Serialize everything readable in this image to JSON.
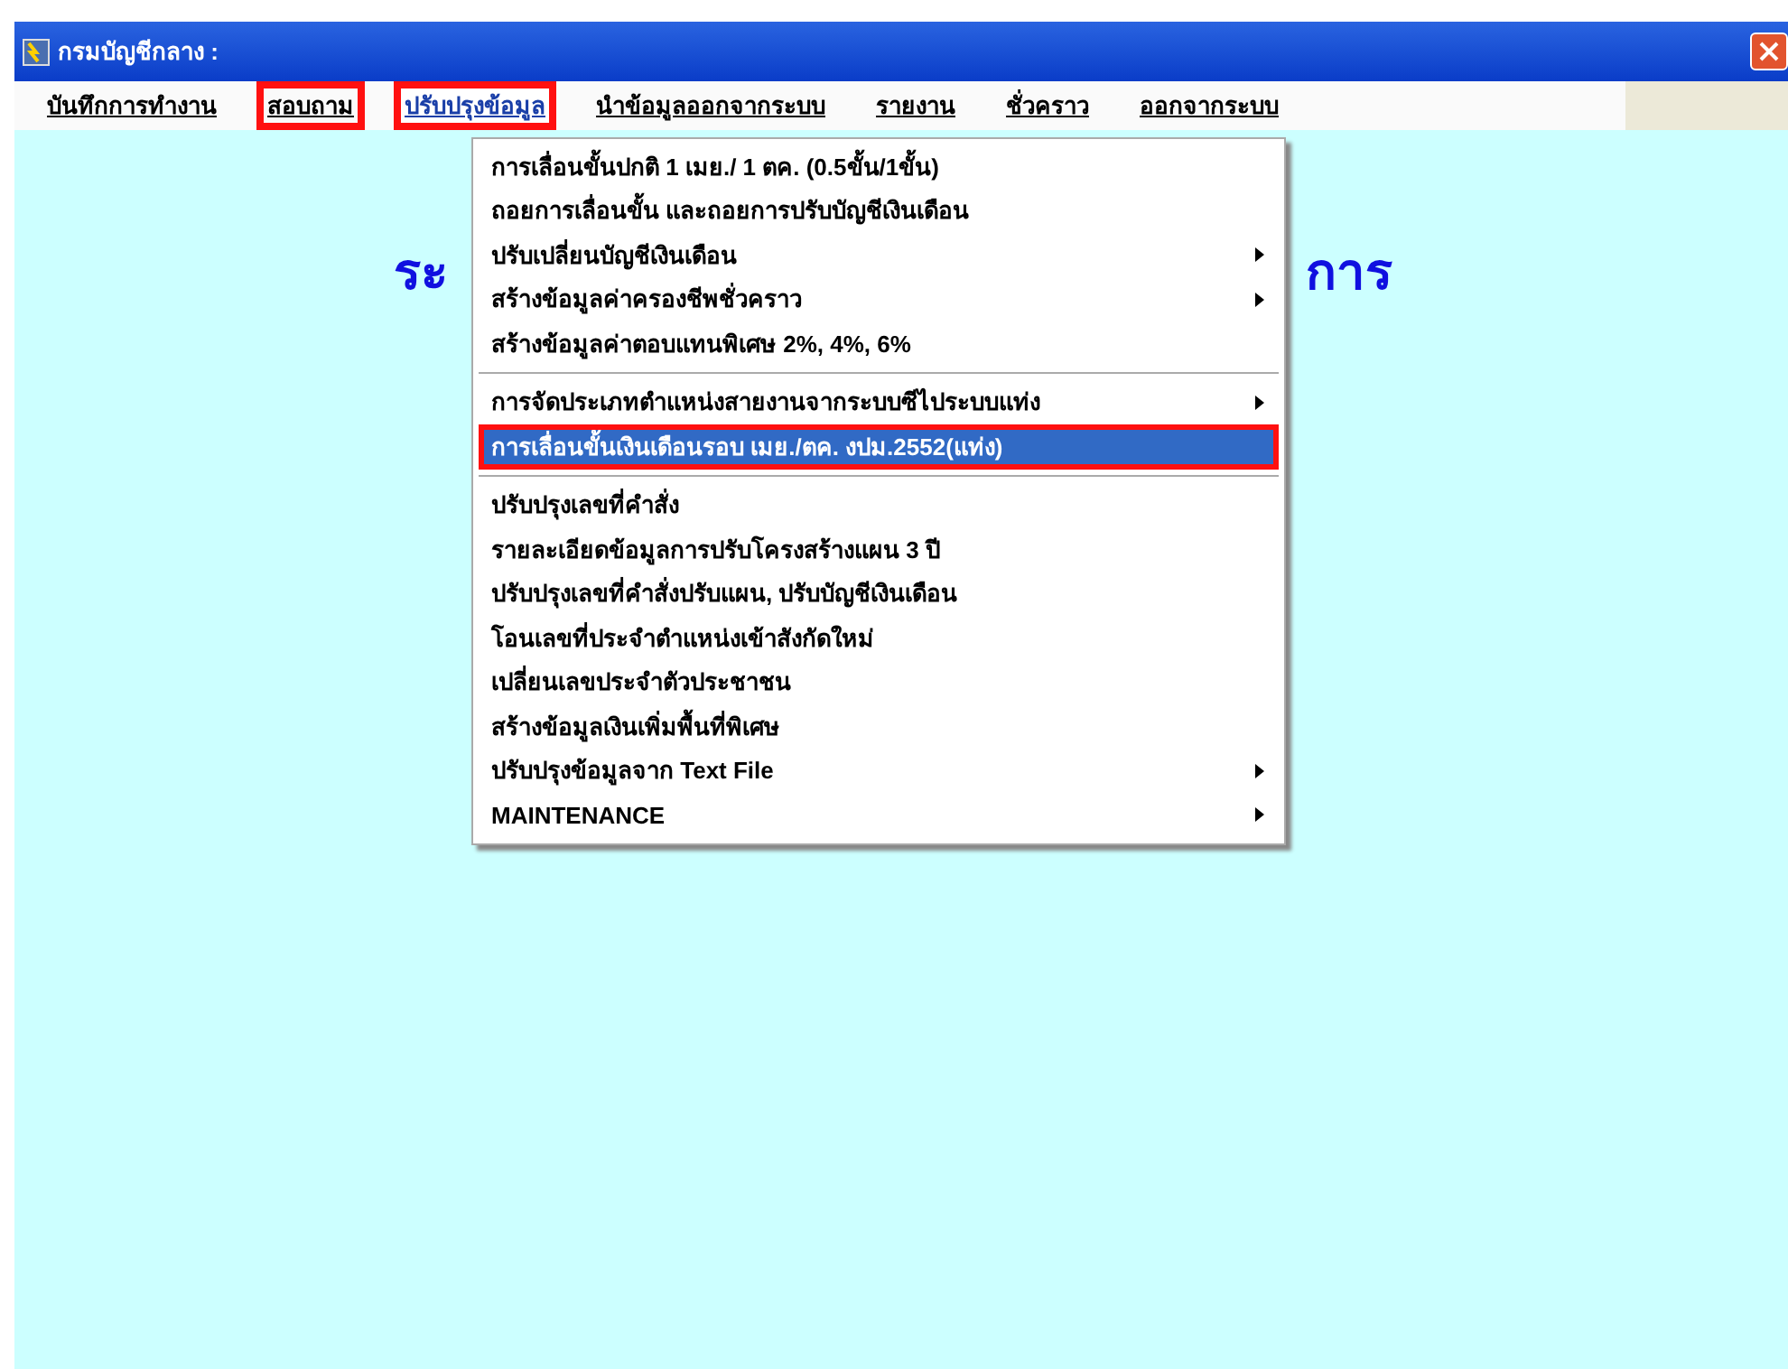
{
  "window": {
    "title": "กรมบัญชีกลาง :"
  },
  "menu_bar": [
    {
      "label": "บันทึกการทำงาน",
      "selected": false,
      "annotated": false
    },
    {
      "label": "สอบถาม",
      "selected": false,
      "annotated": true
    },
    {
      "label": "ปรับปรุงข้อมูล",
      "selected": true,
      "annotated": true
    },
    {
      "label": "นำข้อมูลออกจากระบบ",
      "selected": false,
      "annotated": false
    },
    {
      "label": "รายงาน",
      "selected": false,
      "annotated": false
    },
    {
      "label": "ชั่วคราว",
      "selected": false,
      "annotated": false
    },
    {
      "label": "ออกจากระบบ",
      "selected": false,
      "annotated": false
    }
  ],
  "background_heading": {
    "left": "ระ",
    "right": "การ"
  },
  "dropdown": [
    {
      "kind": "item",
      "label": "การเลื่อนขั้นปกติ  1 เมย./ 1 ตค. (0.5ขั้น/1ขั้น)",
      "submenu": false,
      "selected": false,
      "annotated": false
    },
    {
      "kind": "item",
      "label": "ถอยการเลื่อนขั้น และถอยการปรับบัญชีเงินเดือน",
      "submenu": false,
      "selected": false,
      "annotated": false
    },
    {
      "kind": "item",
      "label": "ปรับเปลี่ยนบัญชีเงินเดือน",
      "submenu": true,
      "selected": false,
      "annotated": false
    },
    {
      "kind": "item",
      "label": "สร้างข้อมูลค่าครองชีพชั่วคราว",
      "submenu": true,
      "selected": false,
      "annotated": false
    },
    {
      "kind": "item",
      "label": "สร้างข้อมูลค่าตอบแทนพิเศษ 2%, 4%, 6%",
      "submenu": false,
      "selected": false,
      "annotated": false
    },
    {
      "kind": "separator"
    },
    {
      "kind": "item",
      "label": "การจัดประเภทตำแหน่งสายงานจากระบบซีไประบบแท่ง",
      "submenu": true,
      "selected": false,
      "annotated": false
    },
    {
      "kind": "item",
      "label": "การเลื่อนขั้นเงินเดือนรอบ เมย./ตค. งปม.2552(แท่ง)",
      "submenu": false,
      "selected": true,
      "annotated": true
    },
    {
      "kind": "separator"
    },
    {
      "kind": "item",
      "label": "ปรับปรุงเลขที่คำสั่ง",
      "submenu": false,
      "selected": false,
      "annotated": false
    },
    {
      "kind": "item",
      "label": "รายละเอียดข้อมูลการปรับโครงสร้างแผน 3 ปี",
      "submenu": false,
      "selected": false,
      "annotated": false
    },
    {
      "kind": "item",
      "label": "ปรับปรุงเลขที่คำสั่งปรับแผน, ปรับบัญชีเงินเดือน",
      "submenu": false,
      "selected": false,
      "annotated": false
    },
    {
      "kind": "item",
      "label": "โอนเลขที่ประจำตำแหน่งเข้าสังกัดใหม่",
      "submenu": false,
      "selected": false,
      "annotated": false
    },
    {
      "kind": "item",
      "label": "เปลี่ยนเลขประจำตัวประชาชน",
      "submenu": false,
      "selected": false,
      "annotated": false
    },
    {
      "kind": "item",
      "label": "สร้างข้อมูลเงินเพิ่มพื้นที่พิเศษ",
      "submenu": false,
      "selected": false,
      "annotated": false
    },
    {
      "kind": "item",
      "label": "ปรับปรุงข้อมูลจาก Text File",
      "submenu": true,
      "selected": false,
      "annotated": false
    },
    {
      "kind": "item",
      "label": "MAINTENANCE",
      "submenu": true,
      "selected": false,
      "annotated": false
    }
  ]
}
